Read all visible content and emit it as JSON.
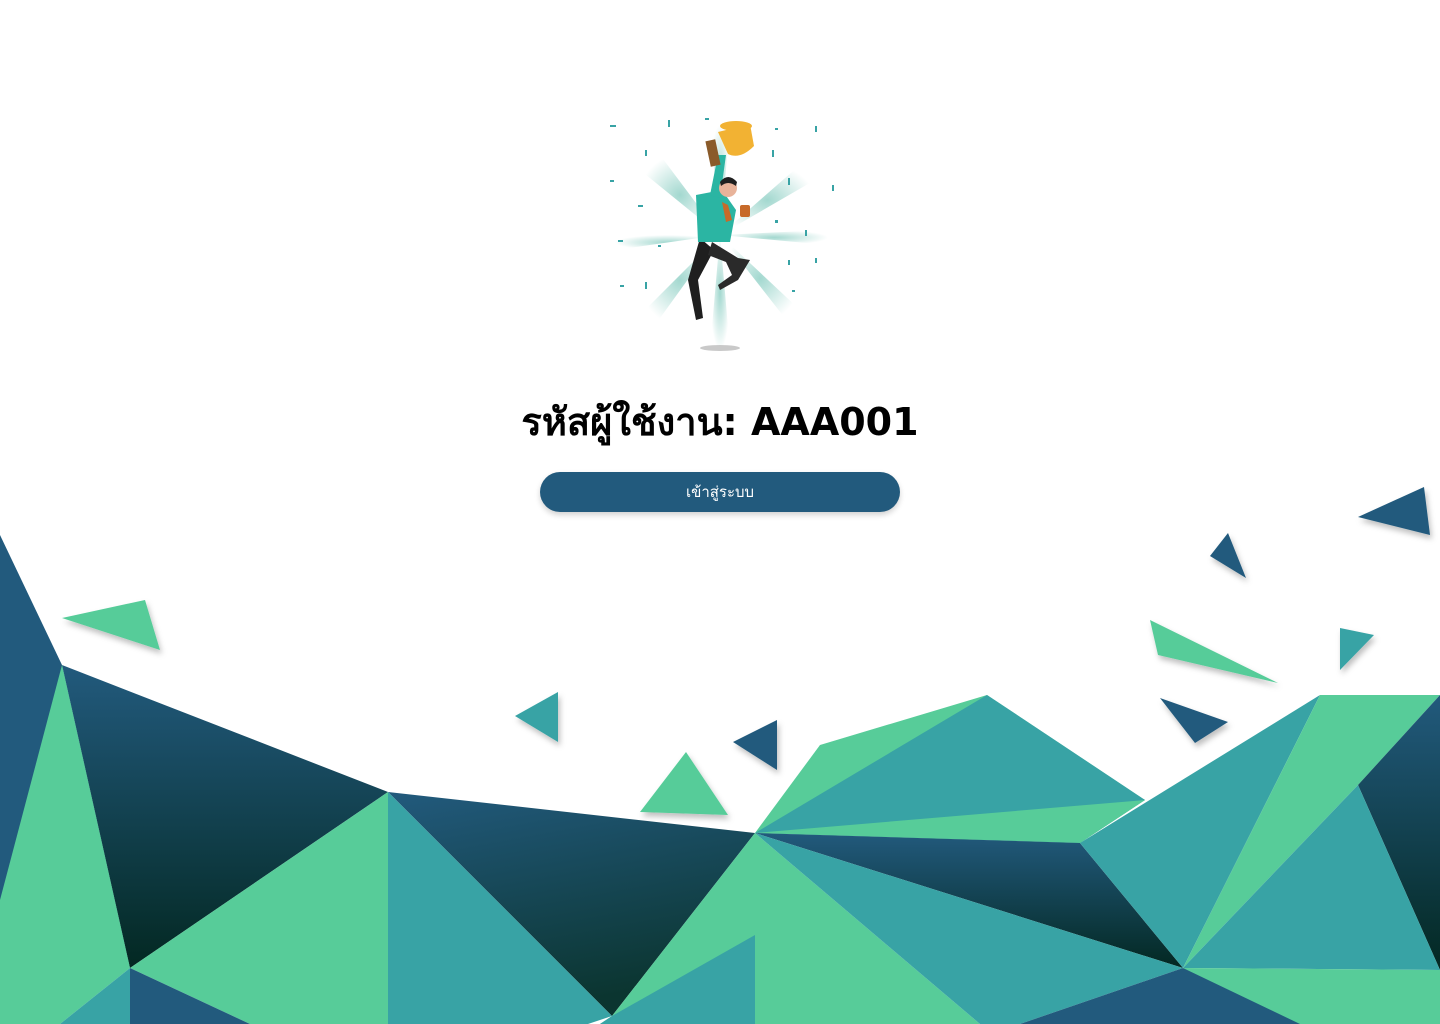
{
  "header": {
    "user_code_label": "รหัสผู้ใช้งาน:",
    "user_code_value": "AAA001"
  },
  "actions": {
    "login_label": "เข้าสู่ระบบ"
  },
  "illustration": {
    "icon": "celebration-trophy-icon"
  },
  "colors": {
    "navy": "#225a7d",
    "teal": "#38a3a5",
    "mint": "#57cc99",
    "dark": "#0a3a35",
    "text": "#000000",
    "button_text": "#ffffff"
  }
}
